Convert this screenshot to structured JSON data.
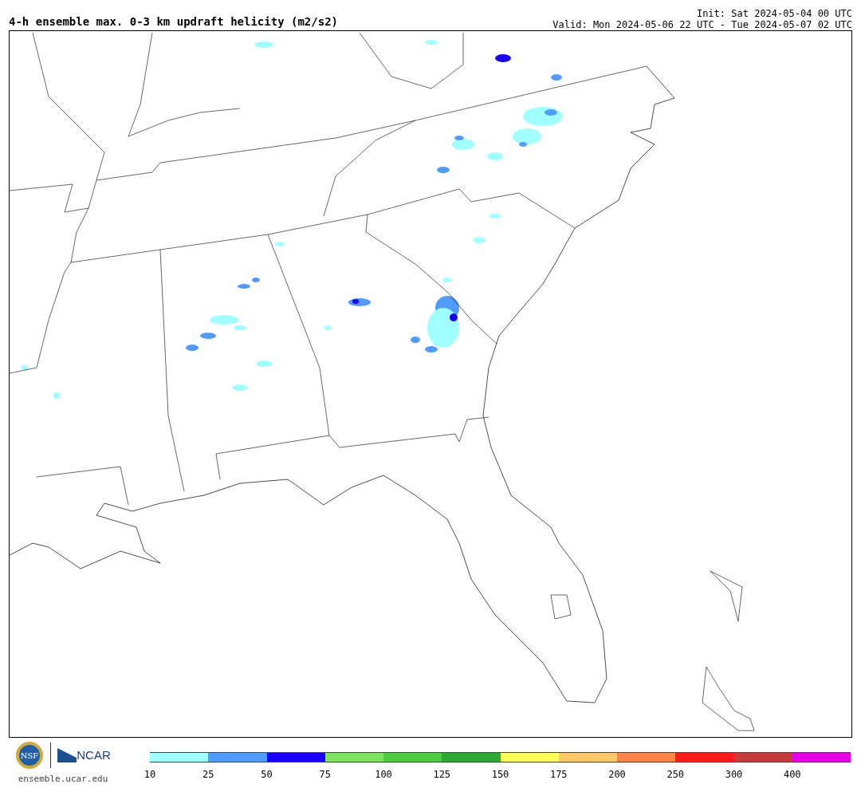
{
  "header": {
    "title": "4-h ensemble max. 0-3 km updraft helicity (m2/s2)",
    "init": "Init: Sat 2024-05-04 00 UTC",
    "valid": "Valid: Mon 2024-05-06 22 UTC - Tue 2024-05-07 02 UTC"
  },
  "footer": {
    "nsf_logo_text": "NSF",
    "ncar_logo_text": "NCAR",
    "site": "ensemble.ucar.edu"
  },
  "colorbar": [
    {
      "label": "10",
      "color": "#a0ffff"
    },
    {
      "label": "25",
      "color": "#4f9bff"
    },
    {
      "label": "50",
      "color": "#1a00ff"
    },
    {
      "label": "75",
      "color": "#7de35c"
    },
    {
      "label": "100",
      "color": "#4dcb41"
    },
    {
      "label": "125",
      "color": "#2daa36"
    },
    {
      "label": "150",
      "color": "#ffff5a"
    },
    {
      "label": "175",
      "color": "#ffc96a"
    },
    {
      "label": "200",
      "color": "#ff8447"
    },
    {
      "label": "250",
      "color": "#ff1a1a"
    },
    {
      "label": "300",
      "color": "#c83b3b"
    },
    {
      "label": "400",
      "color": "#e600e6"
    }
  ]
}
